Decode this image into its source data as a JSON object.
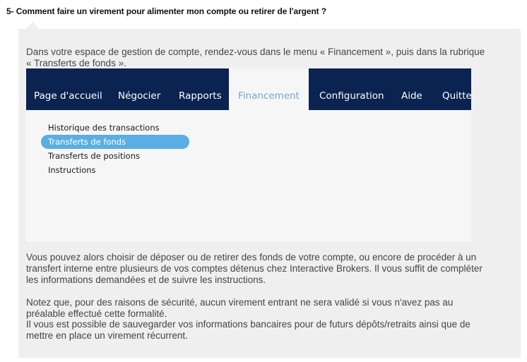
{
  "faq": {
    "question": "5- Comment faire un virement pour alimenter mon compte ou retirer de l'argent ?",
    "intro_line1": "Dans votre espace de gestion de compte, rendez-vous dans le menu « Financement », puis dans la rubrique",
    "intro_line2": "« Transferts de fonds ».",
    "para2_line1": "Vous pouvez alors choisir de déposer ou de retirer des fonds de votre compte, ou encore de procéder à un",
    "para2_line2": "transfert interne entre plusieurs de vos comptes détenus chez Interactive Brokers. Il vous suffit de compléter",
    "para2_line3": "les informations demandées et de suivre les instructions.",
    "para3_line1": "Notez que, pour des raisons de sécurité, aucun virement entrant ne sera validé si vous n'avez pas au",
    "para3_line2": "préalable effectué cette formalité.",
    "para4_line1": "Il vous est possible de sauvegarder vos informations bancaires pour de futurs dépôts/retraits ainsi que de",
    "para4_line2": "mettre en place un virement récurrent."
  },
  "screenshot": {
    "nav": [
      {
        "label": "Page d'accueil"
      },
      {
        "label": "Négocier"
      },
      {
        "label": "Rapports"
      },
      {
        "label": "Financement",
        "active": true
      },
      {
        "label": "Configuration"
      },
      {
        "label": "Aide"
      },
      {
        "label": "Quitter"
      }
    ],
    "submenu": [
      {
        "label": "Historique des transactions"
      },
      {
        "label": "Transferts de fonds",
        "selected": true
      },
      {
        "label": "Transferts de positions"
      },
      {
        "label": "Instructions"
      }
    ],
    "colors": {
      "nav_bg": "#0b2350",
      "active_text": "#7aa4cc",
      "selected_pill": "#5aaee3"
    }
  }
}
